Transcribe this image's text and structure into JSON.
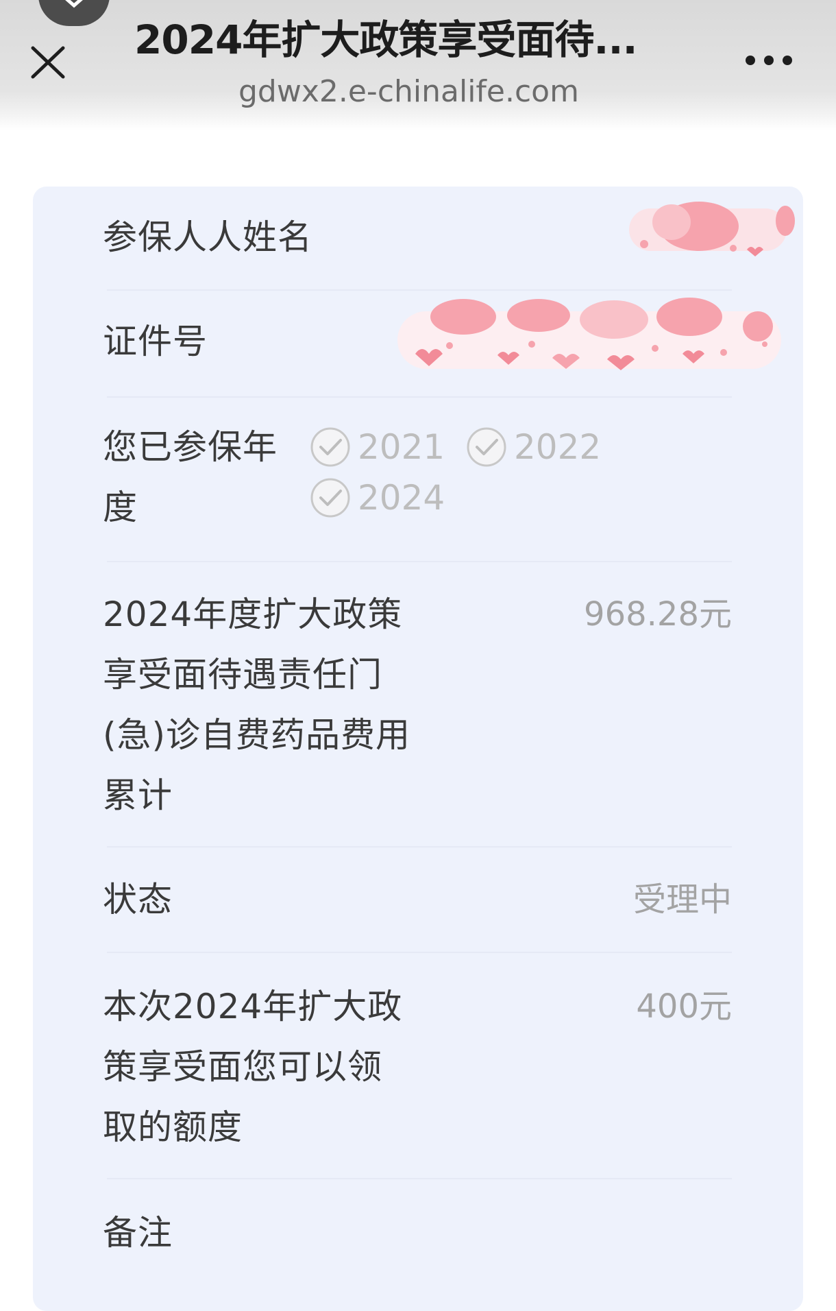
{
  "nav": {
    "title": "2024年扩大政策享受面待...",
    "url": "gdwx2.e-chinalife.com",
    "close_icon": "close-icon",
    "more_icon": "more-dots-icon"
  },
  "form": {
    "name_label": "参保人人姓名",
    "id_label": "证件号",
    "years_label": [
      "您已参保年",
      "度"
    ],
    "years": [
      {
        "label": "2021",
        "checked": true
      },
      {
        "label": "2022",
        "checked": true
      },
      {
        "label": "2024",
        "checked": true
      }
    ],
    "cost_label": [
      "2024年度扩大政策",
      "享受面待遇责任门",
      "(急)诊自费药品费用",
      "累计"
    ],
    "cost_value": "968.28元",
    "status_label": "状态",
    "status_value": "受理中",
    "quota_label": [
      "本次2024年扩大政",
      "策享受面您可以领",
      "取的额度"
    ],
    "quota_value": "400元",
    "remark_label": "备注"
  },
  "colors": {
    "card_bg": "#eef2fc",
    "label_text": "#3a3a3a",
    "value_text": "#a3a3a3",
    "redaction_pink": "#f6a3ad"
  }
}
